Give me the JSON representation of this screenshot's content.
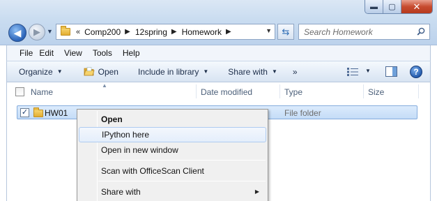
{
  "window": {
    "controls": {
      "minimize": "▬",
      "maximize": "▢",
      "close": "✕"
    }
  },
  "nav": {
    "back": "◀",
    "forward": "▶"
  },
  "address": {
    "overflow": "«",
    "crumbs": [
      "Comp200",
      "12spring",
      "Homework"
    ]
  },
  "search": {
    "placeholder": "Search Homework"
  },
  "menubar": {
    "items": [
      "File",
      "Edit",
      "View",
      "Tools",
      "Help"
    ]
  },
  "toolbar": {
    "organize": "Organize",
    "open": "Open",
    "include": "Include in library",
    "share": "Share with",
    "more": "»"
  },
  "columns": {
    "name": "Name",
    "date": "Date modified",
    "type": "Type",
    "size": "Size"
  },
  "files": [
    {
      "name": "HW01",
      "date_tail": "M",
      "type": "File folder",
      "checked": true
    }
  ],
  "context_menu": {
    "items": [
      {
        "label": "Open",
        "bold": true
      },
      {
        "label": "IPython here",
        "hover": true
      },
      {
        "label": "Open in new window"
      },
      {
        "label": "Scan with OfficeScan Client"
      },
      {
        "label": "Share with",
        "submenu": true
      }
    ]
  },
  "colors": {
    "selection": "#c4dcf7",
    "selection_border": "#84acdd",
    "close_button": "#c74b2f"
  }
}
